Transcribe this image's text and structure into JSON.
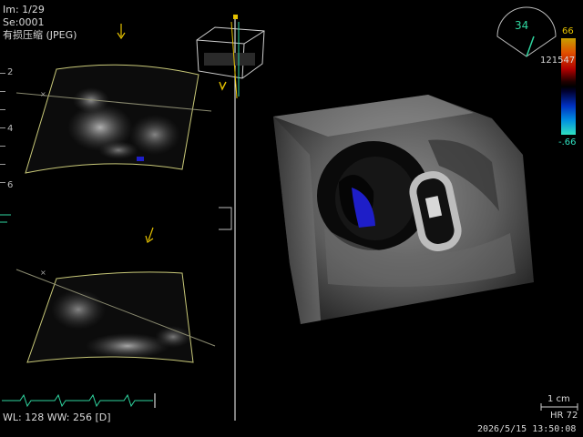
{
  "header": {
    "image_counter": "Im: 1/29",
    "series": "Se:0001",
    "compression": "有损压缩 (JPEG)"
  },
  "depth_scale": [
    "2",
    "4",
    "6"
  ],
  "angle_indicator": {
    "value": "34"
  },
  "colorbar": {
    "top_value": "66",
    "mid_value": "121547",
    "bottom_value": "-.66",
    "colors": [
      "#c8a000",
      "#e05000",
      "#b00000",
      "#200000",
      "#000000",
      "#000030",
      "#0030c0",
      "#0090e0",
      "#30e0c0"
    ]
  },
  "footer": {
    "window_info": "WL: 128 WW: 256 [D]",
    "scale": "1 cm",
    "heart_rate": "HR 72",
    "timestamp": "2026/5/15 13:50:08"
  },
  "colors": {
    "panel_border": "#ffffff",
    "sector_outline": "#c8c878",
    "marker_yellow": "#e6c200",
    "ecg_green": "#2fd6a0",
    "doppler_blue": "#1e1ec8"
  }
}
